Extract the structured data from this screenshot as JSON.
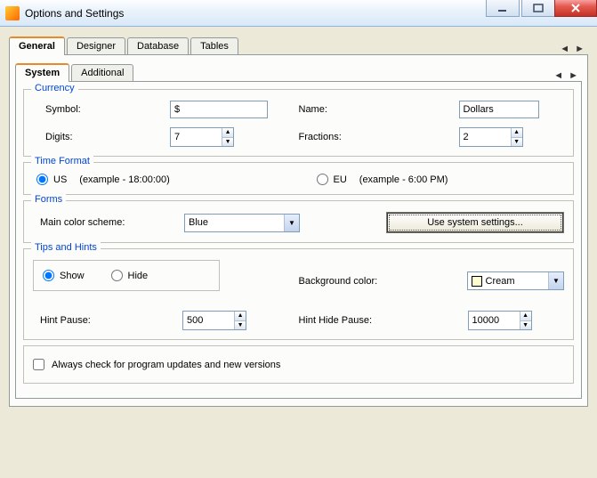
{
  "window": {
    "title": "Options and Settings"
  },
  "tabs": {
    "outer": [
      {
        "label": "General",
        "active": true
      },
      {
        "label": "Designer"
      },
      {
        "label": "Database"
      },
      {
        "label": "Tables"
      }
    ],
    "inner": [
      {
        "label": "System",
        "active": true
      },
      {
        "label": "Additional"
      }
    ]
  },
  "currency": {
    "group_title": "Currency",
    "symbol_label": "Symbol:",
    "symbol_value": "$",
    "name_label": "Name:",
    "name_value": "Dollars",
    "digits_label": "Digits:",
    "digits_value": "7",
    "fractions_label": "Fractions:",
    "fractions_value": "2"
  },
  "time_format": {
    "group_title": "Time Format",
    "us_label": "US",
    "us_example": "(example - 18:00:00)",
    "eu_label": "EU",
    "eu_example": "(example -  6:00 PM)",
    "selected": "US"
  },
  "forms": {
    "group_title": "Forms",
    "scheme_label": "Main color scheme:",
    "scheme_value": "Blue",
    "system_btn": "Use system settings..."
  },
  "tips": {
    "group_title": "Tips and Hints",
    "show_label": "Show",
    "hide_label": "Hide",
    "selected": "Show",
    "bg_label": "Background color:",
    "bg_value": "Cream",
    "pause_label": "Hint Pause:",
    "pause_value": "500",
    "hide_pause_label": "Hint Hide Pause:",
    "hide_pause_value": "10000"
  },
  "updates": {
    "label": "Always check for program updates and new versions",
    "checked": false
  }
}
